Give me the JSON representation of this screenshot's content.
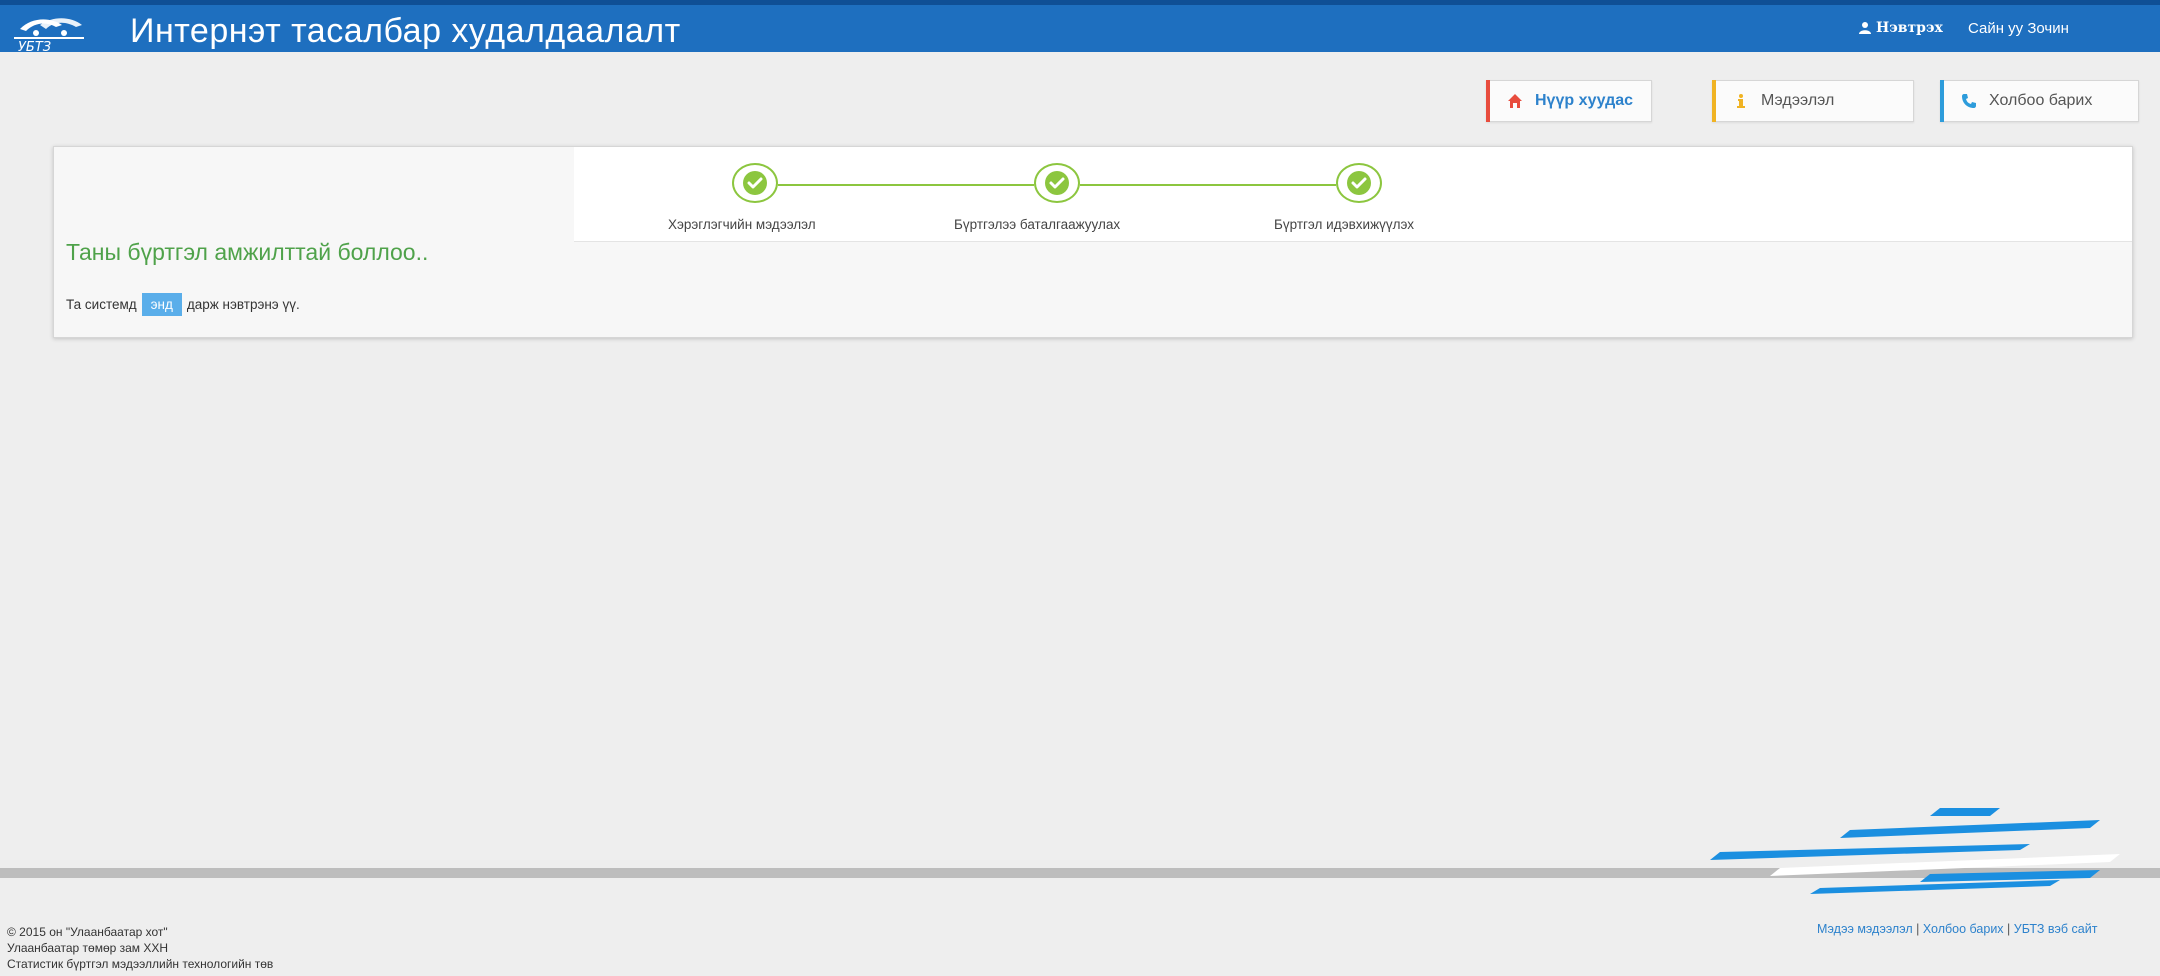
{
  "header": {
    "title": "Интернэт тасалбар худалдаалалт",
    "login_label": "Нэвтрэх",
    "greeting": "Сайн уу Зочин",
    "logo_text": "УБТЗ"
  },
  "nav": {
    "home": "Нүүр хуудас",
    "info": "Мэдээлэл",
    "contact": "Холбоо барих"
  },
  "steps": [
    {
      "label": "Хэрэглэгчийн мэдээлэл",
      "completed": true
    },
    {
      "label": "Бүртгэлээ баталгаажуулах",
      "completed": true
    },
    {
      "label": "Бүртгэл идэвхижүүлэх",
      "completed": true
    }
  ],
  "message": {
    "title": "Таны бүртгэл амжилттай боллоо..",
    "prefix": "Та системд",
    "link": "энд",
    "suffix": "дарж нэвтрэнэ үү."
  },
  "footer": {
    "line1": "© 2015 он \"Улаанбаатар хот\"",
    "line2": "Улаанбаатар төмөр зам ХХН",
    "line3": "Статистик бүртгэл мэдээллийн технологийн төв",
    "links": [
      "Мэдээ мэдээлэл",
      "Холбоо барих",
      "УБТЗ вэб сайт"
    ],
    "separator": "|"
  },
  "colors": {
    "header_bg": "#1e6fbf",
    "step_green": "#8cc63f",
    "success_green": "#4fa24a",
    "link_blue": "#2d82cc",
    "home_accent": "#e84c3d",
    "info_accent": "#f0b323",
    "contact_accent": "#2d9cdb"
  },
  "icons": [
    "user-icon",
    "home-icon",
    "info-icon",
    "phone-icon",
    "check-icon"
  ]
}
